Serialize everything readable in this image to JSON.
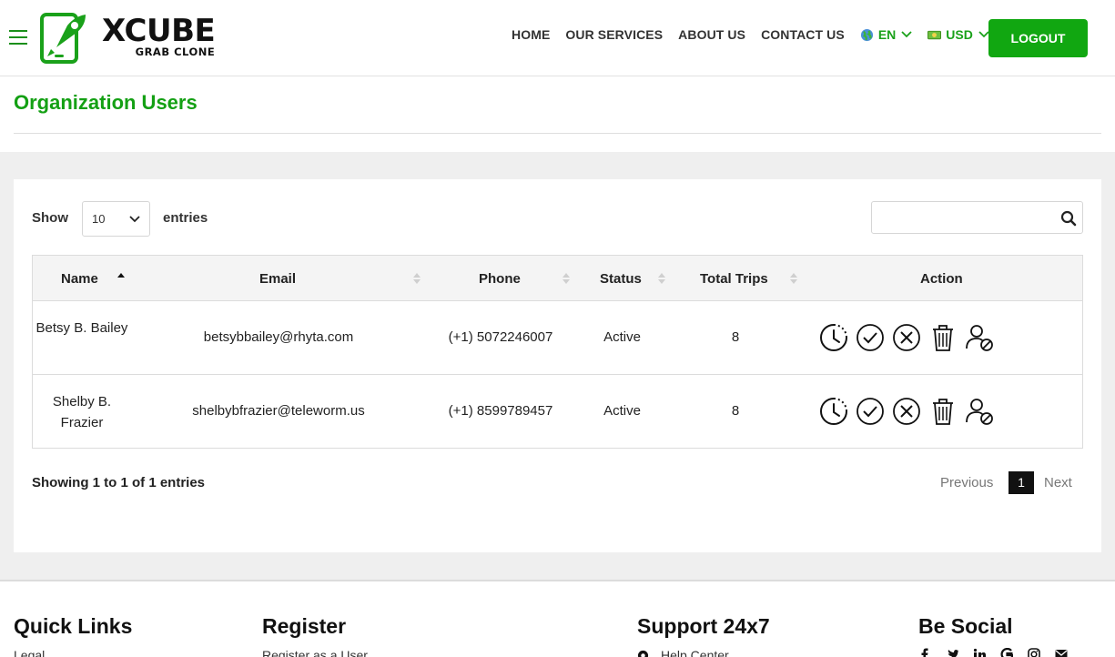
{
  "header": {
    "logo_main": "XCUBE",
    "logo_sub": "GRAB CLONE",
    "nav": [
      "HOME",
      "OUR SERVICES",
      "ABOUT US",
      "CONTACT US"
    ],
    "language": "EN",
    "currency": "USD",
    "logout": "LOGOUT",
    "accent": "#11a711"
  },
  "page": {
    "title": "Organization Users"
  },
  "table_controls": {
    "show_label": "Show",
    "page_size": "10",
    "entries_label": "entries",
    "search_placeholder": ""
  },
  "table": {
    "columns": [
      "Name",
      "Email",
      "Phone",
      "Status",
      "Total Trips",
      "Action"
    ],
    "rows": [
      {
        "name": "Betsy B. Bailey",
        "email": "betsybbailey@rhyta.com",
        "phone": "(+1) 5072246007",
        "status": "Active",
        "trips": "8"
      },
      {
        "name": "Shelby B. Frazier",
        "email": "shelbybfrazier@teleworm.us",
        "phone": "(+1) 8599789457",
        "status": "Active",
        "trips": "8"
      }
    ],
    "action_icons": [
      "history-icon",
      "approve-icon",
      "reject-icon",
      "delete-icon",
      "block-user-icon"
    ]
  },
  "pagination": {
    "summary": "Showing 1 to 1 of 1 entries",
    "previous": "Previous",
    "current": "1",
    "next": "Next"
  },
  "footer": {
    "quick_links": {
      "title": "Quick Links",
      "first": "Legal"
    },
    "register": {
      "title": "Register",
      "first": "Register as a User"
    },
    "support": {
      "title": "Support 24x7",
      "first": "Help Center"
    },
    "social": {
      "title": "Be Social",
      "icons": [
        "facebook-icon",
        "twitter-icon",
        "linkedin-icon",
        "google-icon",
        "instagram-icon",
        "email-icon"
      ]
    }
  }
}
